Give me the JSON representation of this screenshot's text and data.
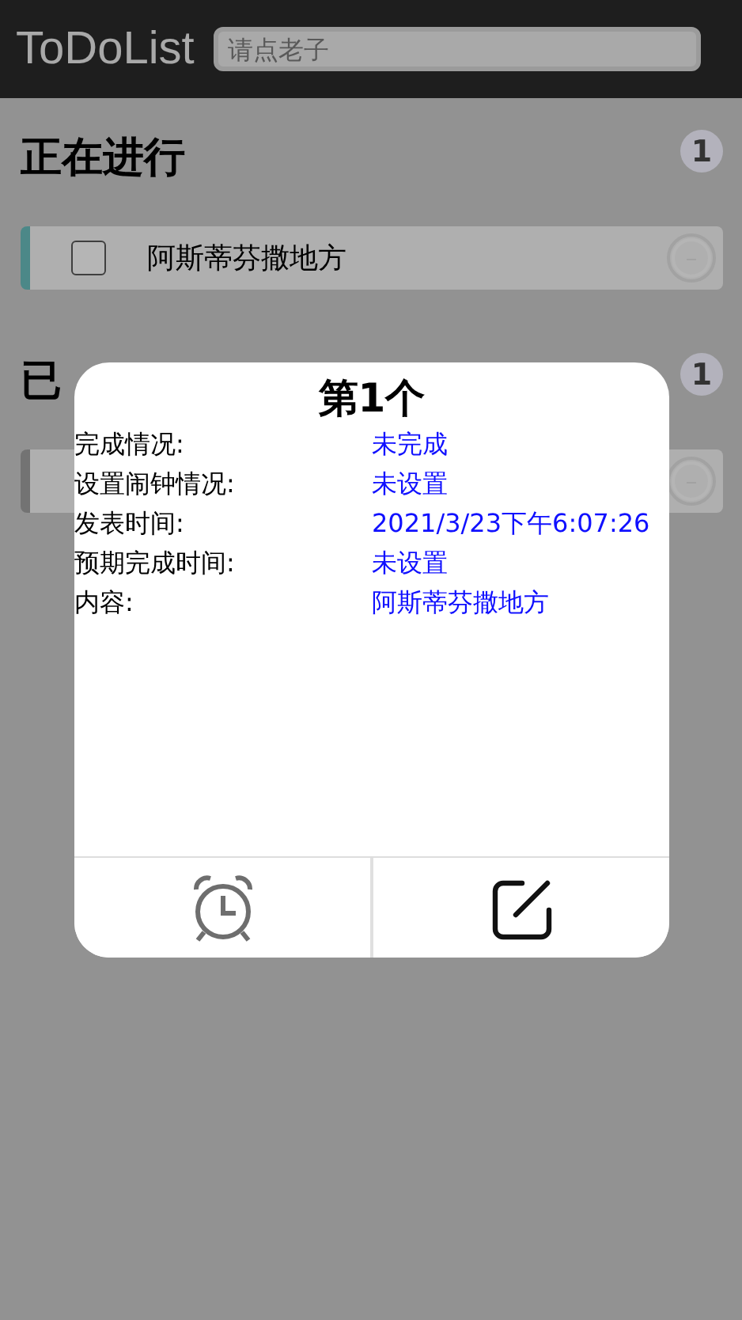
{
  "header": {
    "title": "ToDoList",
    "search": {
      "placeholder": "请点老子"
    }
  },
  "sections": [
    {
      "title": "正在进行",
      "count": "1",
      "items": [
        {
          "text": "阿斯蒂芬撒地方",
          "done": false
        }
      ]
    },
    {
      "title": "已",
      "count": "1",
      "items": [
        {
          "done": true
        }
      ]
    }
  ],
  "dialog": {
    "title": "第1个",
    "rows": [
      {
        "label": "完成情况:",
        "value": "未完成"
      },
      {
        "label": "设置闹钟情况:",
        "value": "未设置"
      },
      {
        "label": "发表时间:",
        "value": "2021/3/23下午6:07:26"
      },
      {
        "label": "预期完成时间:",
        "value": "未设置"
      },
      {
        "label": "内容:",
        "value": "阿斯蒂芬撒地方"
      }
    ],
    "actions": [
      {
        "kind": "alarm"
      },
      {
        "kind": "edit"
      }
    ]
  }
}
